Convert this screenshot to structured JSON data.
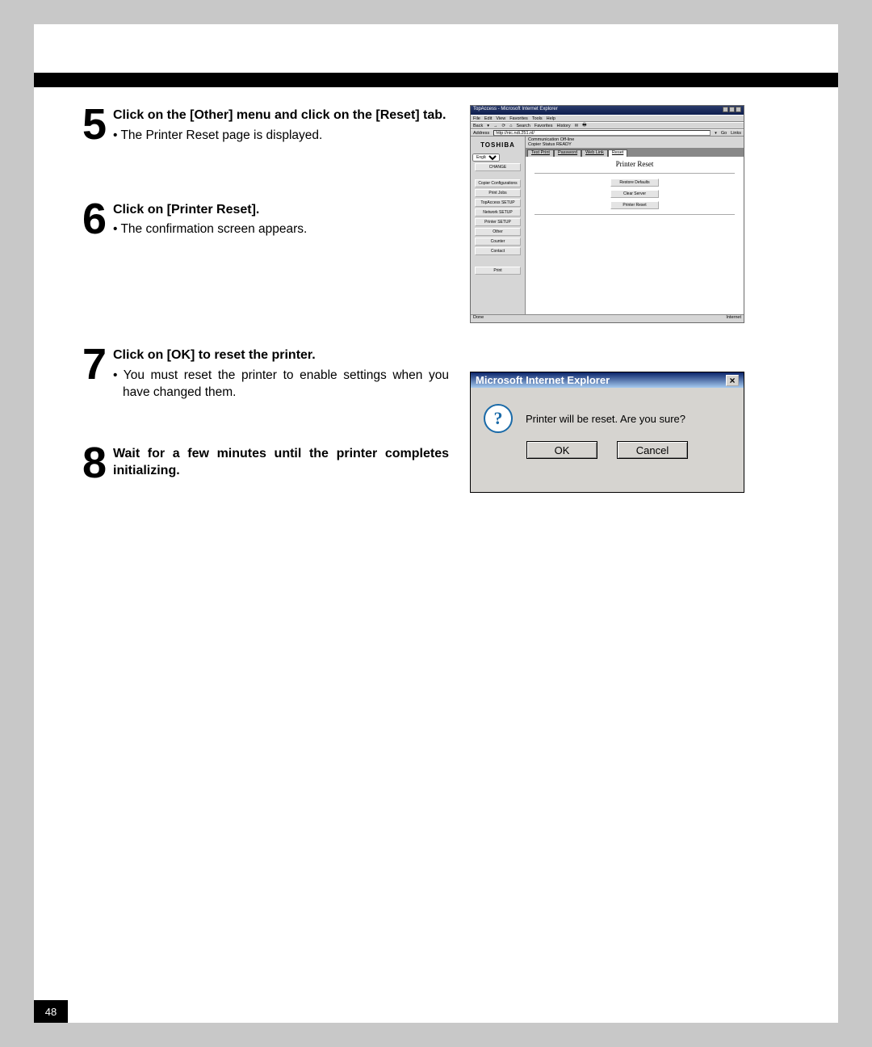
{
  "page_number": "48",
  "steps": [
    {
      "num": "5",
      "heading": "Click on the [Other] menu and click on the [Reset] tab.",
      "bullets": [
        "The Printer Reset page is displayed."
      ]
    },
    {
      "num": "6",
      "heading": "Click on [Printer Reset].",
      "bullets": [
        "The confirmation screen appears."
      ]
    },
    {
      "num": "7",
      "heading": "Click on [OK] to reset the printer.",
      "bullets": [
        "You must reset the printer to enable settings when you have changed them."
      ]
    },
    {
      "num": "8",
      "heading": "Wait for a few minutes until the printer completes initializing.",
      "bullets": []
    }
  ],
  "browser": {
    "title": "TopAccess - Microsoft Internet Explorer",
    "menus": [
      "File",
      "Edit",
      "View",
      "Favorites",
      "Tools",
      "Help"
    ],
    "toolbar": [
      "Back",
      "",
      "",
      "",
      "Search",
      "Favorites",
      "History",
      "",
      ""
    ],
    "address_label": "Address",
    "address_value": "http://nic.ndi.251.nl/",
    "go": "Go",
    "links": "Links",
    "logo": "TOSHIBA",
    "status_lines": [
      "Communication Off-line",
      "Copier Status READY"
    ],
    "lang": "English",
    "side_buttons": [
      "CHANGE",
      "Copier Configurations",
      "Print Jobs",
      "TopAccess SETUP",
      "Network SETUP",
      "Printer SETUP",
      "Other",
      "Counter",
      "Contact",
      "",
      "Print"
    ],
    "tabs": [
      "Test Print",
      "Password",
      "Web Link",
      "Reset"
    ],
    "active_tab": 3,
    "panel_title": "Printer Reset",
    "panel_buttons": [
      "Restore Defaults",
      "Clear Server",
      "Printer Reset"
    ],
    "footer_left": "Done",
    "footer_right": "Internet"
  },
  "dialog": {
    "title": "Microsoft Internet Explorer",
    "message": "Printer will be reset.  Are you sure?",
    "ok": "OK",
    "cancel": "Cancel"
  }
}
